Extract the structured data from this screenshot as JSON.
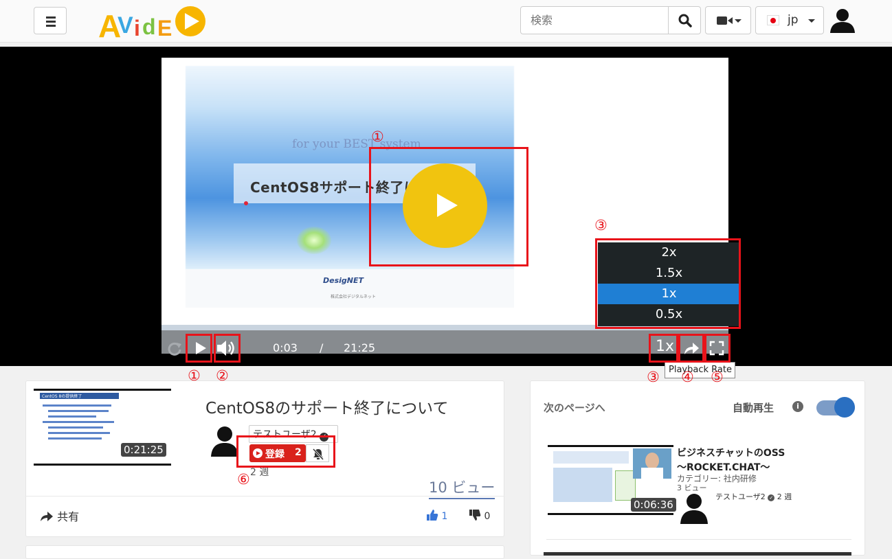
{
  "header": {
    "logo_text": "AVidE",
    "search_placeholder": "検索",
    "language_label": "jp"
  },
  "player": {
    "slide_subtitle": "for your BEST system",
    "slide_title": "CentOS8サポート終了について",
    "slide_logo": "DesigNET",
    "slide_logo_sub": "株式会社デジタルネット",
    "current_time": "0:03",
    "separator": "/",
    "duration": "21:25",
    "rate_button_label": "1x",
    "rate_options": [
      "2x",
      "1.5x",
      "1x",
      "0.5x"
    ],
    "selected_rate": "1x",
    "tooltip": "Playback Rate"
  },
  "annotations": {
    "n1": "①",
    "n2": "②",
    "n3": "③",
    "n4": "④",
    "n5": "⑤",
    "n6": "⑥"
  },
  "video_info": {
    "thumb_duration": "0:21:25",
    "thumb_heading": "CentOS 8の提供終了",
    "title": "CentOS8のサポート終了について",
    "uploader": "テストユーザ2",
    "subscribe_label": "登録",
    "subscriber_count": "2",
    "time_ago": "2 週",
    "views": "10 ビュー",
    "share_label": "共有",
    "likes": "1",
    "dislikes": "0"
  },
  "sidebar": {
    "heading": "次のページへ",
    "autoplay_label": "自動再生",
    "autoplay_on": true,
    "info_symbol": "i",
    "next_video": {
      "title_line1": "ビジネスチャットのOSS",
      "title_line2": "～ROCKET.CHAT～",
      "category": "カテゴリー: 社内研修",
      "views": "3 ビュー",
      "uploader": "テストユーザ2",
      "time_ago": "2 週",
      "duration": "0:06:36"
    }
  },
  "colors": {
    "annotation_red": "#e8131a",
    "play_button": "#f1c40f",
    "rate_selected": "#1f7fd4",
    "subscribe": "#d9221c",
    "toggle": "#2a6fc1"
  }
}
